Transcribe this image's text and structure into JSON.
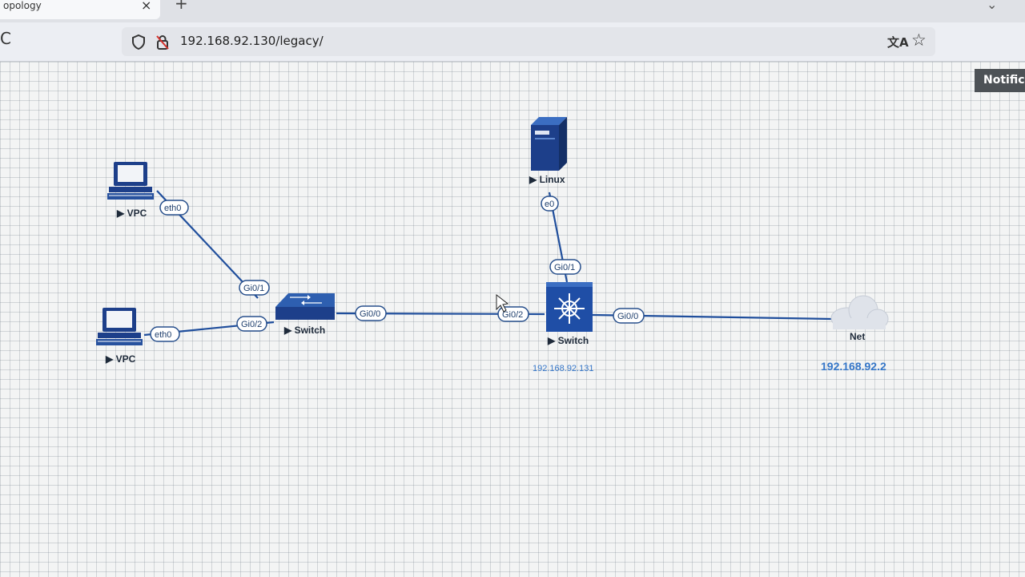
{
  "browser": {
    "tab_title": "opology",
    "tab_close": "×",
    "new_tab": "+",
    "tab_list": "⌄",
    "reload": "C",
    "url": "192.168.92.130/legacy/",
    "notification": "Notific"
  },
  "topology": {
    "nodes": [
      {
        "id": "vpc1",
        "label": "▶ VPC",
        "icon": "vpc-computer-icon"
      },
      {
        "id": "vpc2",
        "label": "▶ VPC",
        "icon": "vpc-computer-icon"
      },
      {
        "id": "switch1",
        "label": "▶ Switch",
        "icon": "switch-icon"
      },
      {
        "id": "switch2",
        "label": "▶ Switch",
        "icon": "layer3-switch-icon",
        "ip": "192.168.92.131"
      },
      {
        "id": "linux",
        "label": "▶ Linux",
        "icon": "server-icon"
      },
      {
        "id": "net",
        "label": "Net",
        "icon": "cloud-icon",
        "ip": "192.168.92.2"
      }
    ],
    "interfaces": {
      "vpc1_eth0": "eth0",
      "vpc2_eth0": "eth0",
      "sw1_gi01": "Gi0/1",
      "sw1_gi02": "Gi0/2",
      "sw1_gi00": "Gi0/0",
      "sw2_gi02": "Gi0/2",
      "sw2_gi01": "Gi0/1",
      "sw2_gi00": "Gi0/0",
      "linux_e0": "e0"
    },
    "links": [
      [
        "vpc1",
        "switch1"
      ],
      [
        "vpc2",
        "switch1"
      ],
      [
        "switch1",
        "switch2"
      ],
      [
        "linux",
        "switch2"
      ],
      [
        "switch2",
        "net"
      ]
    ],
    "colors": {
      "link": "#1f4e9c",
      "node": "#1d3f8a",
      "ip": "#3576c8"
    }
  }
}
